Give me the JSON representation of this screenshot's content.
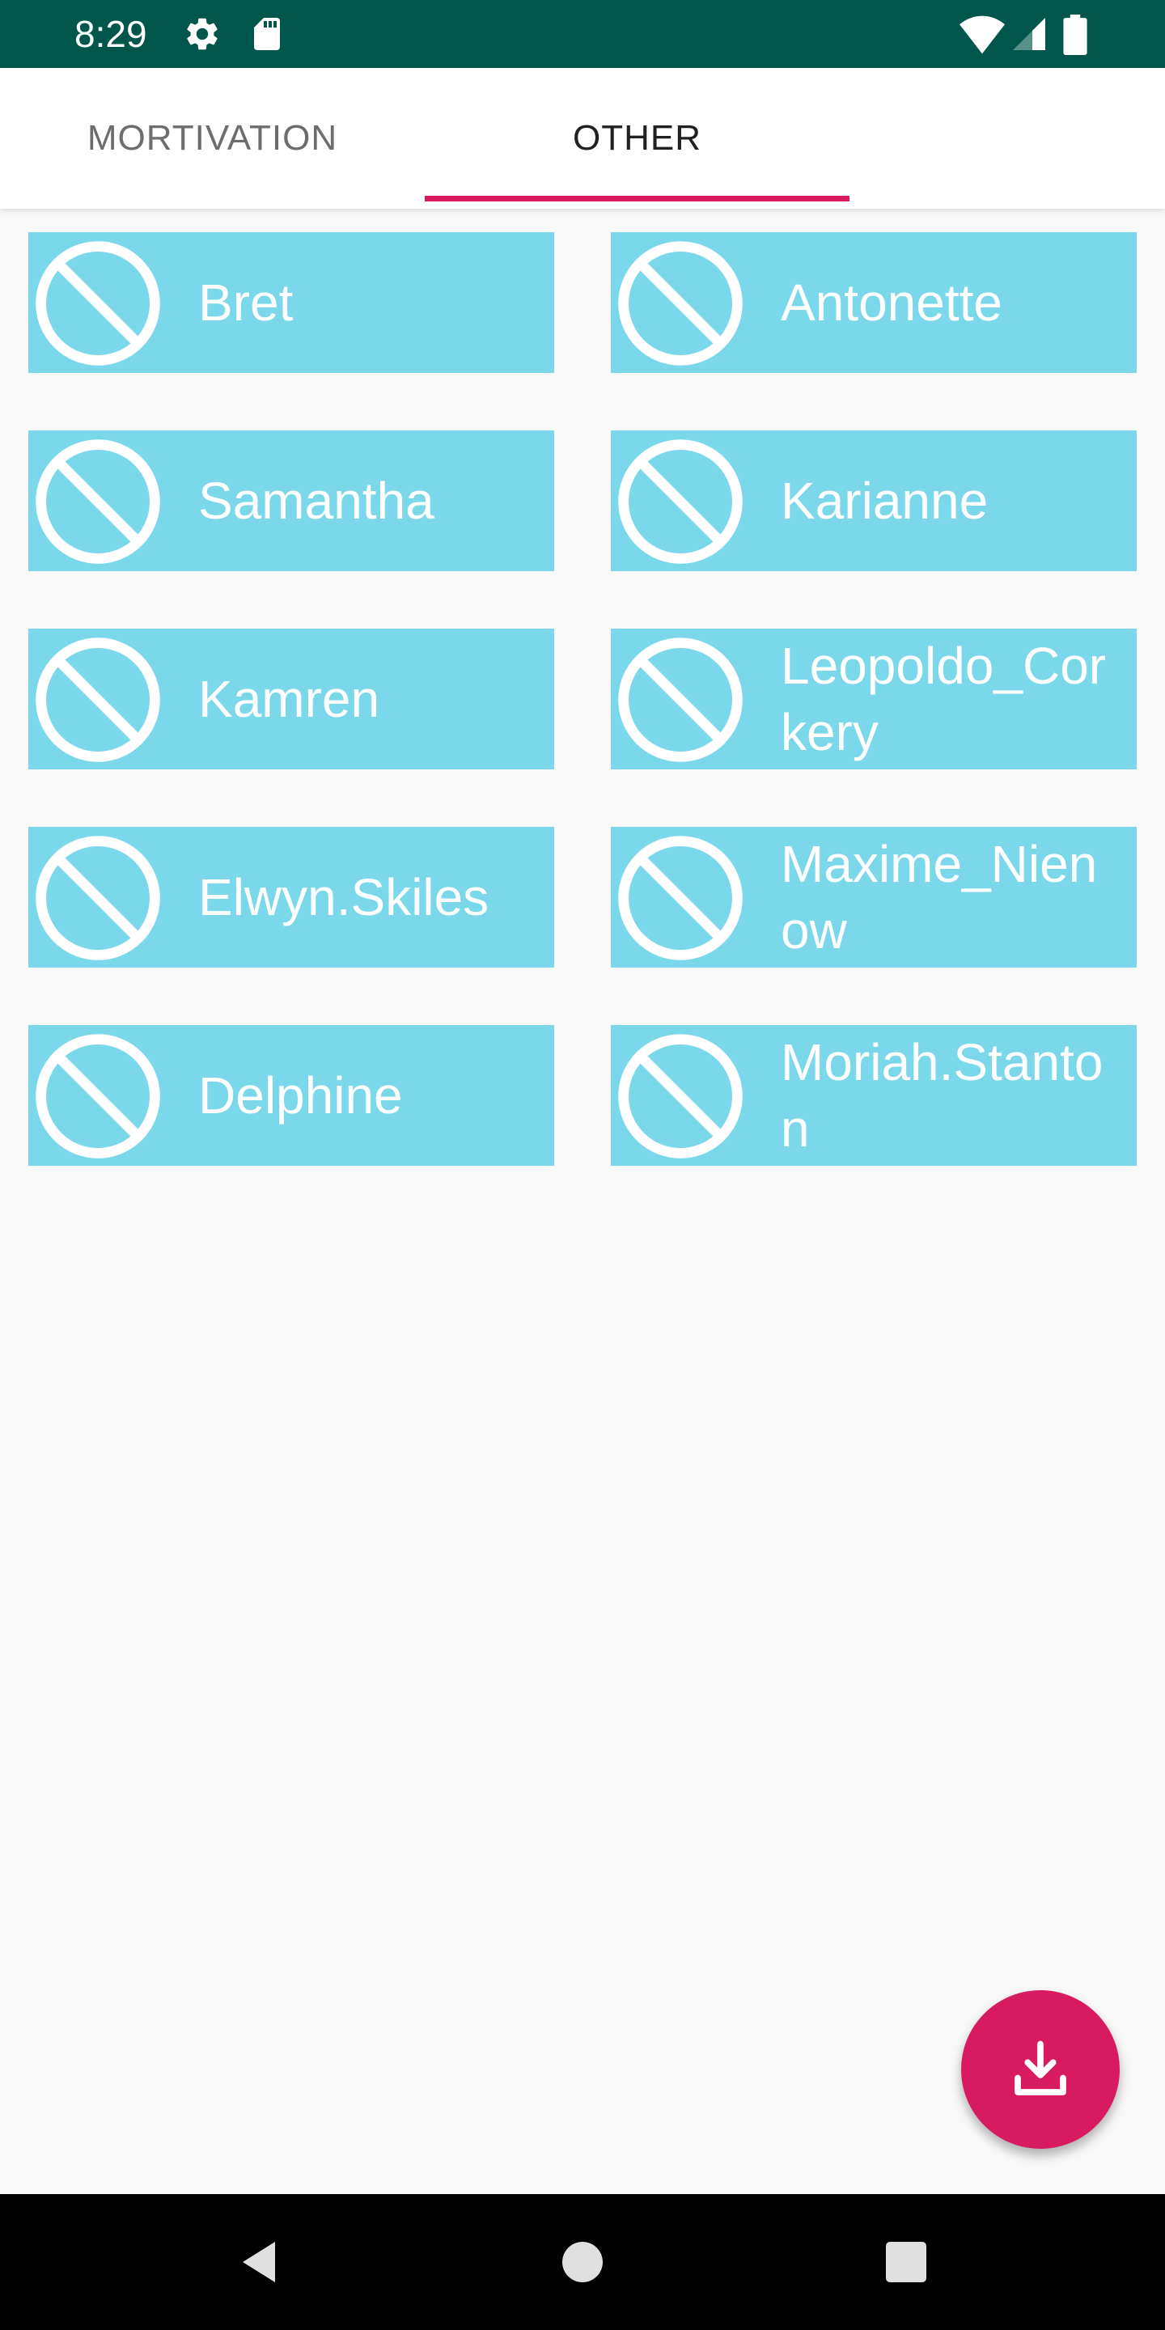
{
  "status_bar": {
    "time": "8:29",
    "icons": [
      "settings-icon",
      "sd-card-icon",
      "wifi-icon",
      "signal-icon",
      "battery-icon"
    ],
    "background": "#00564a"
  },
  "tabs": [
    {
      "label": "MORTIVATION",
      "selected": false
    },
    {
      "label": "OTHER",
      "selected": true
    }
  ],
  "accent_color": "#d81b60",
  "card_color": "#7ad8ea",
  "users": [
    {
      "name": "Bret",
      "icon": "block-icon"
    },
    {
      "name": "Antonette",
      "icon": "block-icon"
    },
    {
      "name": "Samantha",
      "icon": "block-icon"
    },
    {
      "name": "Karianne",
      "icon": "block-icon"
    },
    {
      "name": "Kamren",
      "icon": "block-icon"
    },
    {
      "name": "Leopoldo_Corkery",
      "icon": "block-icon"
    },
    {
      "name": "Elwyn.Skiles",
      "icon": "block-icon"
    },
    {
      "name": "Maxime_Nienow",
      "icon": "block-icon"
    },
    {
      "name": "Delphine",
      "icon": "block-icon"
    },
    {
      "name": "Moriah.Stanton",
      "icon": "block-icon"
    }
  ],
  "fab": {
    "icon": "download-icon"
  },
  "nav_bar": {
    "buttons": [
      "back-icon",
      "home-icon",
      "recents-icon"
    ]
  }
}
